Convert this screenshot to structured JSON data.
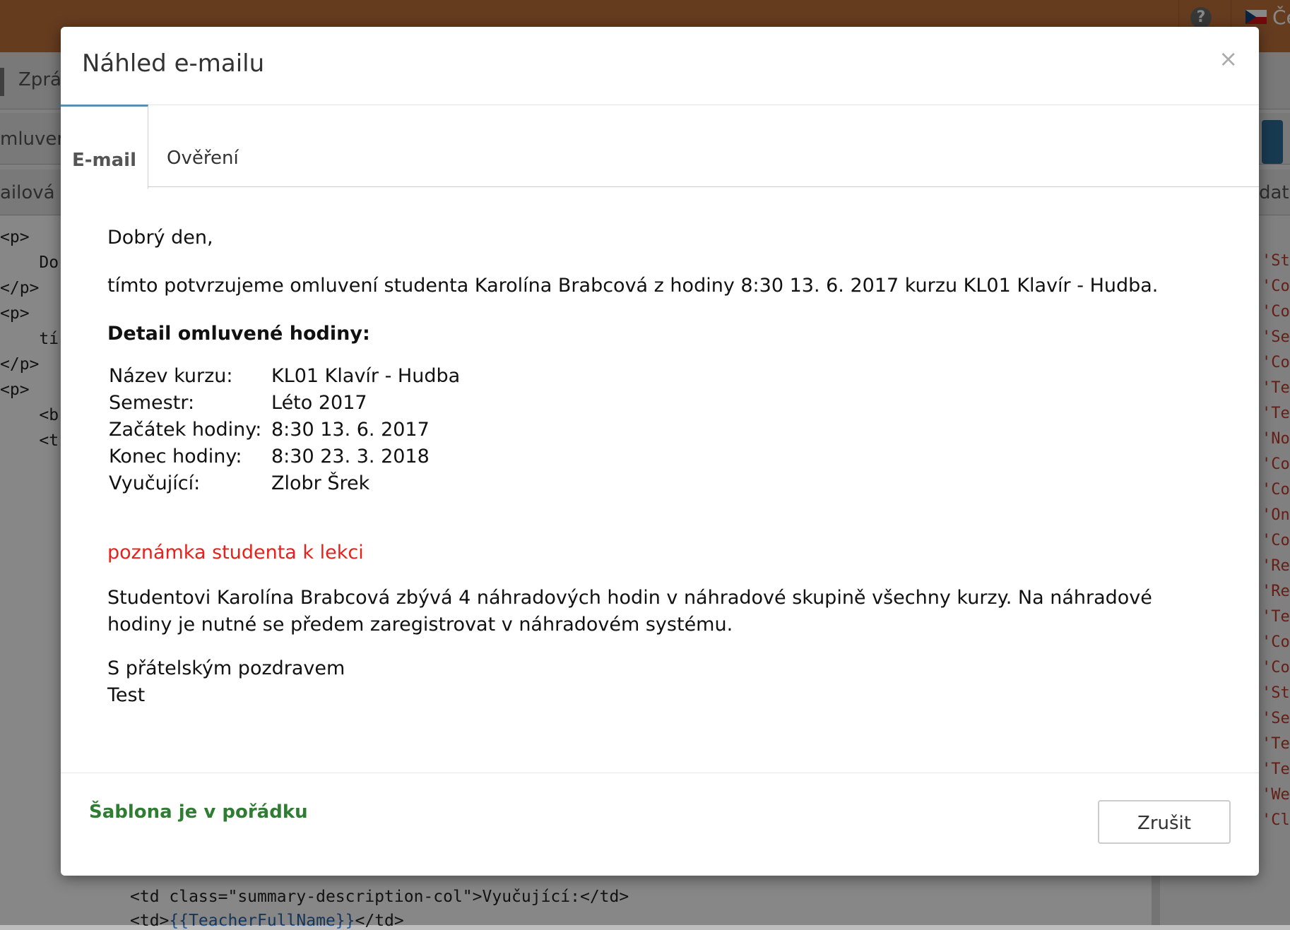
{
  "background": {
    "lang_label": "Če",
    "nav_text": "Zpráv",
    "row2_text": "mluvená",
    "row3_text": "ailová ša",
    "row3_right": "data",
    "code_lines": [
      "<p>",
      "    Do",
      "</p>",
      "<p>",
      "    tí",
      "</p>",
      "<p>",
      "    <b",
      "    <t"
    ],
    "code_bottom_1": "<td class=\"summary-description-col\">Vyučující:</td>",
    "code_bottom_2_prefix": "<td>",
    "code_bottom_2_token": "{{TeacherFullName}}",
    "code_bottom_2_suffix": "</td>",
    "side_items": [
      "'Stu",
      "'Cou",
      "'Cou",
      "'Sen",
      "'Cou",
      "'Tea",
      "'Tea",
      "'NoC",
      "'Cou",
      "'Cou",
      "'One",
      "'Cou",
      "'Ren",
      "'Ren",
      "'Ter",
      "'Con",
      "'Cou",
      "'Stu",
      "'Sen",
      "'Ter",
      "'Ter",
      "'Wel",
      "'Cla"
    ]
  },
  "modal": {
    "title": "Náhled e-mailu",
    "close_symbol": "×",
    "tabs": [
      {
        "label": "E-mail",
        "active": true
      },
      {
        "label": "Ověření",
        "active": false
      }
    ],
    "email": {
      "greeting": "Dobrý den,",
      "confirmation": "tímto potvrzujeme omluvení studenta Karolína Brabcová z hodiny 8:30 13. 6. 2017 kurzu KL01 Klavír - Hudba.",
      "detail_heading": "Detail omluvené hodiny:",
      "details": [
        {
          "label": "Název kurzu:",
          "value": "KL01 Klavír - Hudba"
        },
        {
          "label": "Semestr:",
          "value": "Léto 2017"
        },
        {
          "label": "Začátek hodiny:",
          "value": "8:30 13. 6. 2017"
        },
        {
          "label": "Konec hodiny:",
          "value": "8:30 23. 3. 2018"
        },
        {
          "label": "Vyučující:",
          "value": "Zlobr Šrek"
        }
      ],
      "student_note": "poznámka studenta k lekci",
      "makeup_info": "Studentovi Karolína Brabcová zbývá 4 náhradových hodin v náhradové skupině všechny kurzy. Na náhradové hodiny je nutné se předem zaregistrovat v náhradovém systému.",
      "signoff": "S přátelským pozdravem",
      "signature": "Test"
    },
    "status": "Šablona je v pořádku",
    "cancel_label": "Zrušit"
  },
  "colors": {
    "topbar": "#c0713c",
    "tab_accent": "#5b8fb0",
    "note": "#e8201c",
    "status_ok": "#2e7d32"
  }
}
